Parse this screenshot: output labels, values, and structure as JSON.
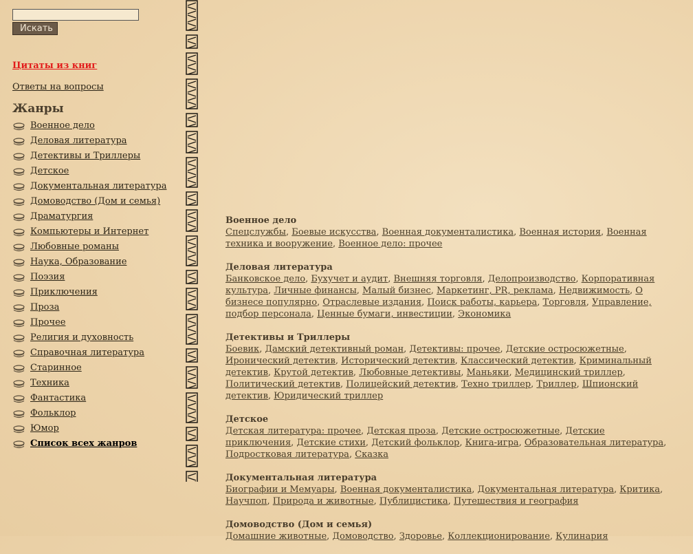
{
  "search": {
    "placeholder": "",
    "button_label": "Искать"
  },
  "links": {
    "quotes": "Цитаты из книг",
    "answers": "Ответы на вопросы"
  },
  "genres_title": "Жанры",
  "genres": [
    "Военное дело",
    "Деловая литература",
    "Детективы и Триллеры",
    "Детское",
    "Документальная литература",
    "Домоводство (Дом и семья)",
    "Драматургия",
    "Компьютеры и Интернет",
    "Любовные романы",
    "Наука, Образование",
    "Поэзия",
    "Приключения",
    "Проза",
    "Прочее",
    "Религия и духовность",
    "Справочная литература",
    "Старинное",
    "Техника",
    "Фантастика",
    "Фольклор",
    "Юмор"
  ],
  "all_genres": "Список всех жанров",
  "sections": [
    {
      "title": "Военное дело",
      "items": [
        "Спецслужбы",
        "Боевые искусства",
        "Военная документалистика",
        "Военная история",
        "Военная техника и вооружение",
        "Военное дело: прочее"
      ]
    },
    {
      "title": "Деловая литература",
      "items": [
        "Банковское дело",
        "Бухучет и аудит",
        "Внешняя торговля",
        "Делопроизводство",
        "Корпоративная культура",
        "Личные финансы",
        "Малый бизнес",
        "Маркетинг, PR, реклама",
        "Недвижимость",
        "О бизнесе популярно",
        "Отраслевые издания",
        "Поиск работы, карьера",
        "Торговля",
        "Управление, подбор персонала",
        "Ценные бумаги, инвестиции",
        "Экономика"
      ]
    },
    {
      "title": "Детективы и Триллеры",
      "items": [
        "Боевик",
        "Дамский детективный роман",
        "Детективы: прочее",
        "Детские остросюжетные",
        "Иронический детектив",
        "Исторический детектив",
        "Классический детектив",
        "Криминальный детектив",
        "Крутой детектив",
        "Любовные детективы",
        "Маньяки",
        "Медицинский триллер",
        "Политический детектив",
        "Полицейский детектив",
        "Техно триллер",
        "Триллер",
        "Шпионский детектив",
        "Юридический триллер"
      ]
    },
    {
      "title": "Детское",
      "items": [
        "Детская литература: прочее",
        "Детская проза",
        "Детские остросюжетные",
        "Детские приключения",
        "Детские стихи",
        "Детский фольклор",
        "Книга-игра",
        "Образовательная литература",
        "Подростковая литература",
        "Сказка"
      ]
    },
    {
      "title": "Документальная литература",
      "items": [
        "Биографии и Мемуары",
        "Военная документалистика",
        "Документальная литература",
        "Критика",
        "Научпоп",
        "Природа и животные",
        "Публицистика",
        "Путешествия и география"
      ]
    },
    {
      "title": "Домоводство (Дом и семья)",
      "items": [
        "Домашние животные",
        "Домоводство",
        "Здоровье",
        "Коллекционирование",
        "Кулинария"
      ]
    }
  ]
}
